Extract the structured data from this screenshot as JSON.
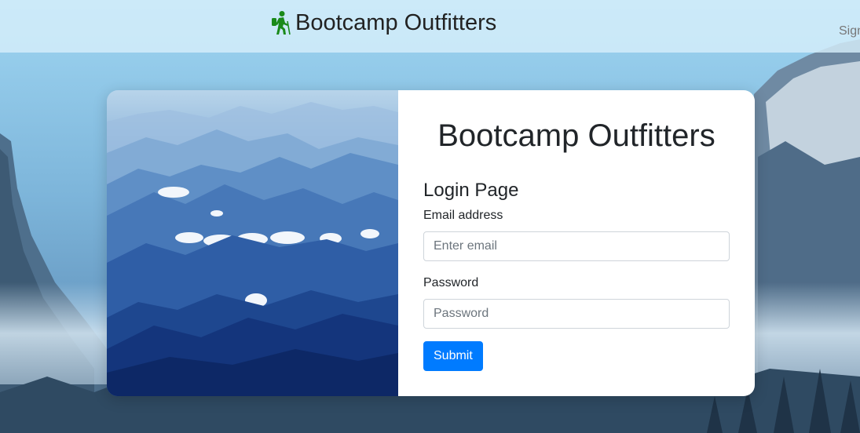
{
  "navbar": {
    "brand_icon": "hiking-icon",
    "brand_text": "Bootcamp Outfitters",
    "brand_icon_color": "#1a8a1a",
    "signin_label": "Sign"
  },
  "card": {
    "image": "mountain-landscape-image",
    "title": "Bootcamp Outfitters",
    "login_heading": "Login Page",
    "email": {
      "label": "Email address",
      "placeholder": "Enter email",
      "value": ""
    },
    "password": {
      "label": "Password",
      "placeholder": "Password",
      "value": ""
    },
    "submit_label": "Submit"
  },
  "colors": {
    "primary": "#007bff",
    "navbar_bg": "#d6eefa",
    "card_bg": "#ffffff"
  }
}
